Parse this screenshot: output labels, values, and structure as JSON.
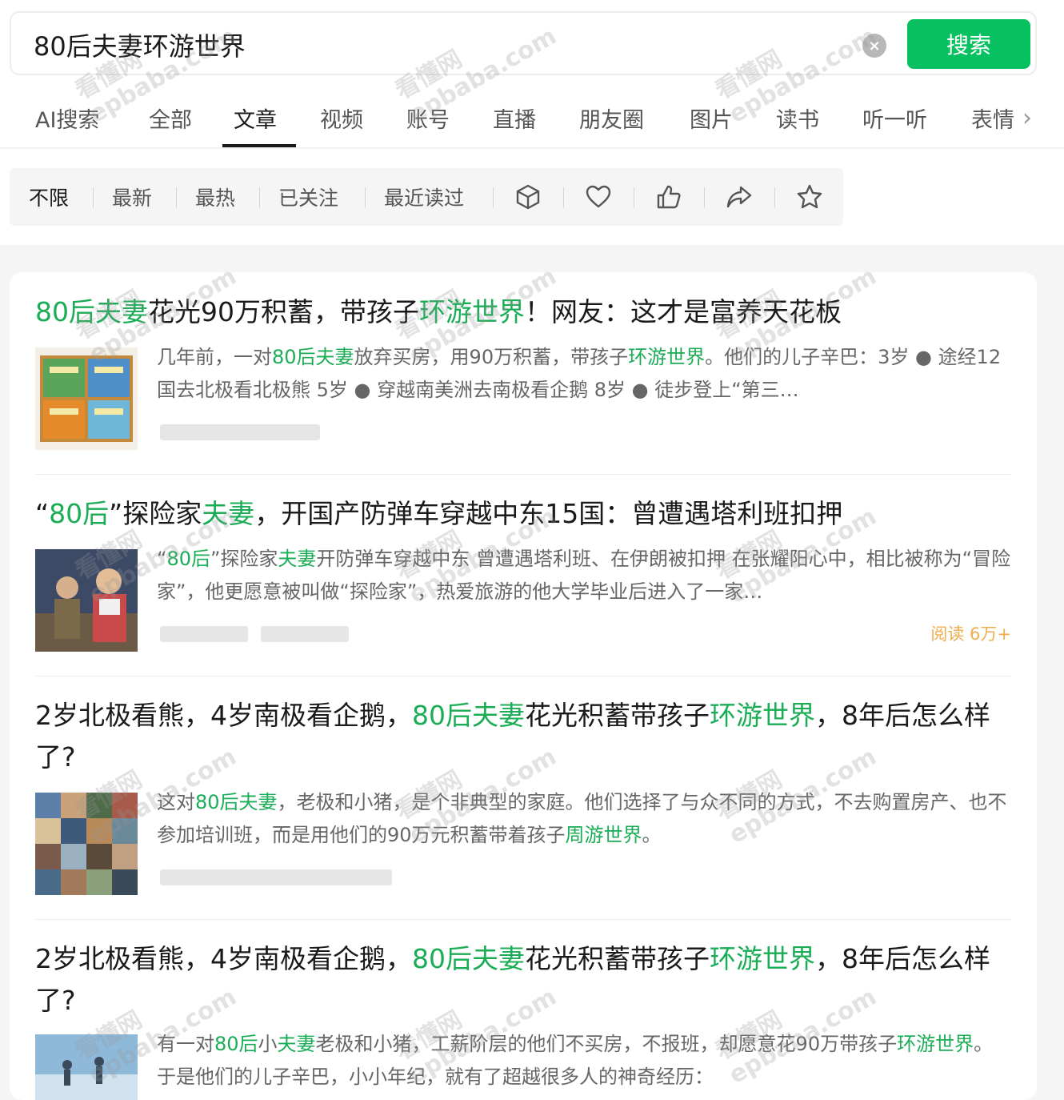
{
  "search": {
    "query": "80后夫妻环游世界",
    "clear_symbol": "×",
    "button_label": "搜索"
  },
  "tabs": [
    "AI搜索",
    "全部",
    "文章",
    "视频",
    "账号",
    "直播",
    "朋友圈",
    "图片",
    "读书",
    "听一听",
    "表情"
  ],
  "active_tab": "文章",
  "tab_more_symbol": "›",
  "filters": [
    "不限",
    "最新",
    "最热",
    "已关注",
    "最近读过"
  ],
  "filter_icons": [
    "cube-icon",
    "heart-icon",
    "thumbs-up-icon",
    "share-icon",
    "star-icon"
  ],
  "results": [
    {
      "title_parts": [
        {
          "t": "80后夫妻",
          "hl": true
        },
        {
          "t": "花光90万积蓄，带孩子",
          "hl": false
        },
        {
          "t": "环游世界",
          "hl": true
        },
        {
          "t": "！网友：这才是富养天花板",
          "hl": false
        }
      ],
      "snippet_parts": [
        {
          "t": "几年前，一对",
          "hl": false
        },
        {
          "t": "80后夫妻",
          "hl": true
        },
        {
          "t": "放弃买房，用90万积蓄，带孩子",
          "hl": false
        },
        {
          "t": "环游世界",
          "hl": true
        },
        {
          "t": "。他们的儿子辛巴：3岁 ● 途经12国去北极看北极熊 5岁 ● 穿越南美洲去南极看企鹅 8岁 ● 徒步登上“第三…",
          "hl": false
        }
      ],
      "read_count": ""
    },
    {
      "title_parts": [
        {
          "t": "“",
          "hl": false
        },
        {
          "t": "80后",
          "hl": true
        },
        {
          "t": "”探险家",
          "hl": false
        },
        {
          "t": "夫妻",
          "hl": true
        },
        {
          "t": "，开国产防弹车穿越中东15国：曾遭遇塔利班扣押",
          "hl": false
        }
      ],
      "snippet_parts": [
        {
          "t": "“",
          "hl": false
        },
        {
          "t": "80后",
          "hl": true
        },
        {
          "t": "”探险家",
          "hl": false
        },
        {
          "t": "夫妻",
          "hl": true
        },
        {
          "t": "开防弹车穿越中东 曾遭遇塔利班、在伊朗被扣押 在张耀阳心中，相比被称为“冒险家”，他更愿意被叫做“探险家”，热爱旅游的他大学毕业后进入了一家…",
          "hl": false
        }
      ],
      "read_count": "阅读 6万+"
    },
    {
      "title_parts": [
        {
          "t": "2岁北极看熊，4岁南极看企鹅，",
          "hl": false
        },
        {
          "t": "80后夫妻",
          "hl": true
        },
        {
          "t": "花光积蓄带孩子",
          "hl": false
        },
        {
          "t": "环游世界",
          "hl": true
        },
        {
          "t": "，8年后怎么样了?",
          "hl": false
        }
      ],
      "snippet_parts": [
        {
          "t": "这对",
          "hl": false
        },
        {
          "t": "80后夫妻",
          "hl": true
        },
        {
          "t": "，老极和小猪，是个非典型的家庭。他们选择了与众不同的方式，不去购置房产、也不参加培训班，而是用他们的90万元积蓄带着孩子",
          "hl": false
        },
        {
          "t": "周游世界",
          "hl": true
        },
        {
          "t": "。",
          "hl": false
        }
      ],
      "read_count": ""
    },
    {
      "title_parts": [
        {
          "t": "2岁北极看熊，4岁南极看企鹅，",
          "hl": false
        },
        {
          "t": "80后夫妻",
          "hl": true
        },
        {
          "t": "花光积蓄带孩子",
          "hl": false
        },
        {
          "t": "环游世界",
          "hl": true
        },
        {
          "t": "，8年后怎么样了?",
          "hl": false
        }
      ],
      "snippet_parts": [
        {
          "t": "有一对",
          "hl": false
        },
        {
          "t": "80后",
          "hl": true
        },
        {
          "t": "小",
          "hl": false
        },
        {
          "t": "夫妻",
          "hl": true
        },
        {
          "t": "老极和小猪，工薪阶层的他们不买房，不报班，却愿意花90万带孩子",
          "hl": false
        },
        {
          "t": "环游世界",
          "hl": true
        },
        {
          "t": "。于是他们的儿子辛巴，小小年纪，就有了超越很多人的神奇经历：",
          "hl": false
        }
      ],
      "read_count": ""
    }
  ],
  "watermark": {
    "line1": "看懂网",
    "line2": "epbaba.com"
  }
}
